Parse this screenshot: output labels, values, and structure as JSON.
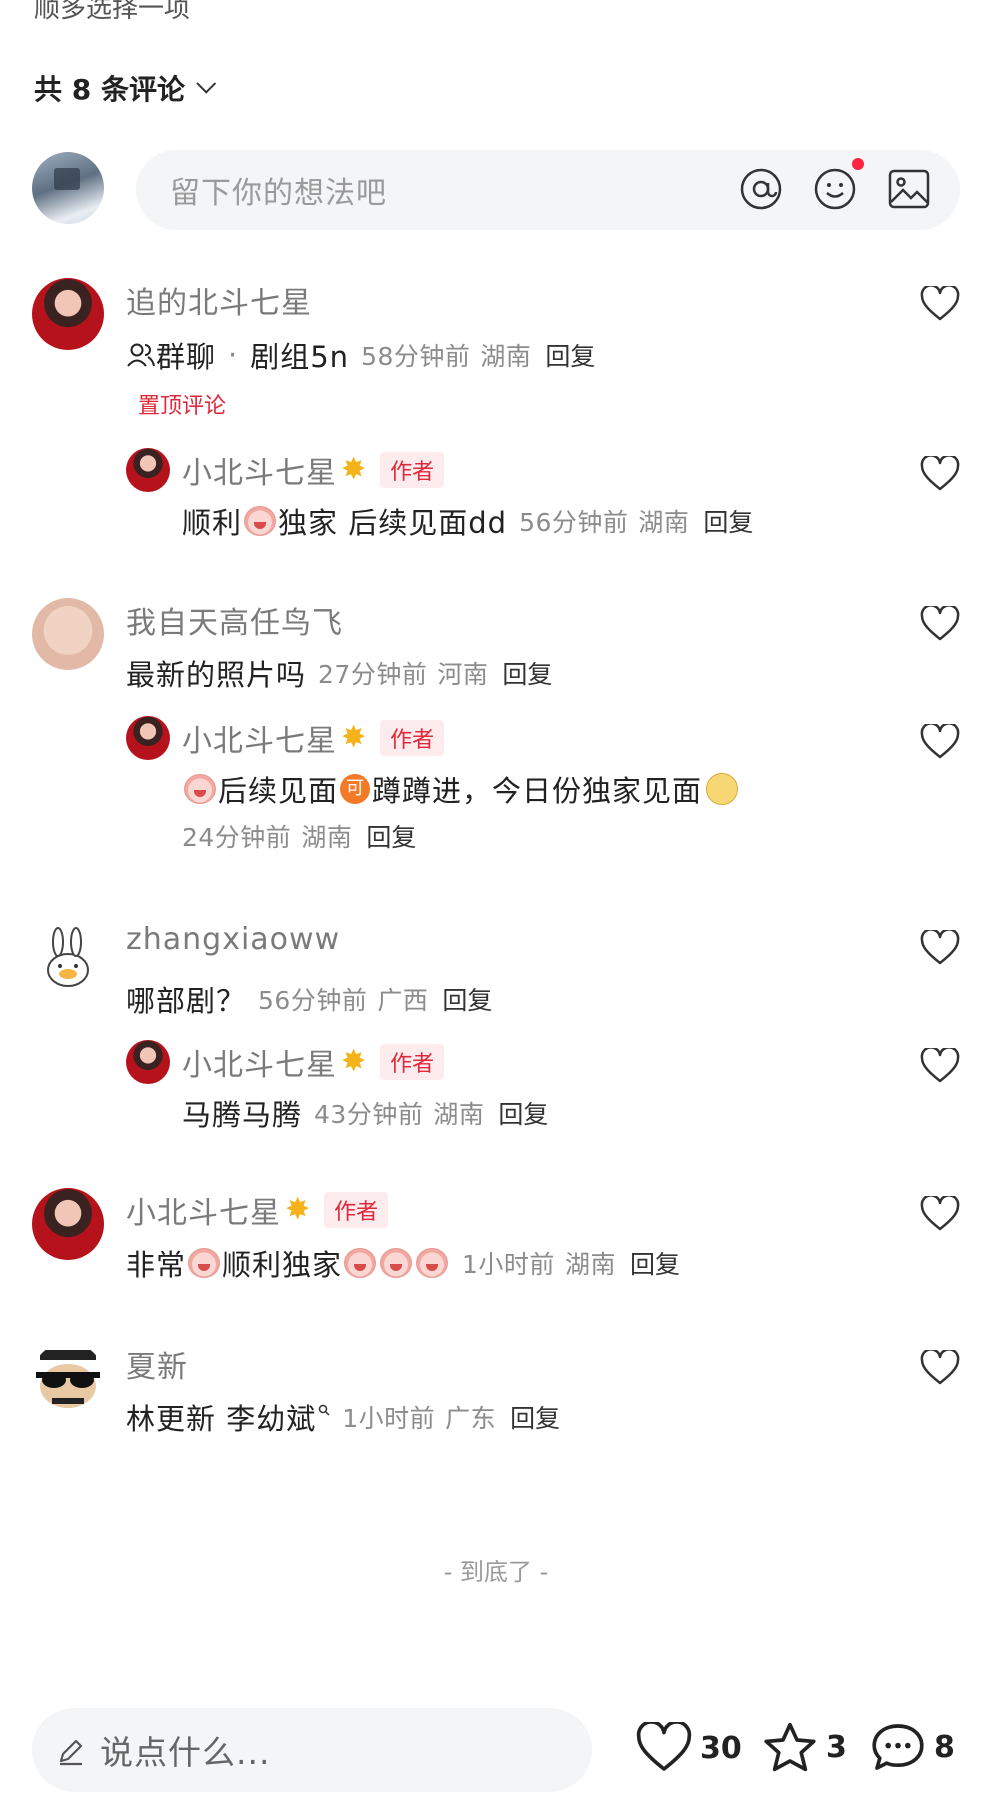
{
  "top_cut_text": "顺多选择一项",
  "comments_header": {
    "label": "共 8 条评论"
  },
  "composer": {
    "placeholder": "留下你的想法吧"
  },
  "comments": [
    {
      "name": "追的北斗七星",
      "group_label": "群聊",
      "dot": "·",
      "crew": "剧组5n",
      "time": "58分钟前",
      "location": "湖南",
      "reply": "回复",
      "pinned": "置顶评论",
      "reply_item": {
        "name": "小北斗七星",
        "author_tag": "作者",
        "text_a": "顺利",
        "text_b": "独家 后续见面dd",
        "time": "56分钟前",
        "location": "湖南",
        "reply": "回复"
      }
    },
    {
      "name": "我自天高任鸟飞",
      "text": "最新的照片吗",
      "time": "27分钟前",
      "location": "河南",
      "reply": "回复",
      "reply_item": {
        "name": "小北斗七星",
        "author_tag": "作者",
        "text_a": "后续见面",
        "coin": "可",
        "text_b": "蹲蹲进，今日份独家见面",
        "time": "24分钟前",
        "location": "湖南",
        "reply": "回复"
      }
    },
    {
      "name": "zhangxiaoww",
      "text": "哪部剧？",
      "time": "56分钟前",
      "location": "广西",
      "reply": "回复",
      "reply_item": {
        "name": "小北斗七星",
        "author_tag": "作者",
        "text": "马腾马腾",
        "time": "43分钟前",
        "location": "湖南",
        "reply": "回复"
      }
    },
    {
      "name": "小北斗七星",
      "author_tag": "作者",
      "text_a": "非常",
      "text_b": "顺利独家",
      "time": "1小时前",
      "location": "湖南",
      "reply": "回复"
    },
    {
      "name": "夏新",
      "text": "林更新 李幼斌",
      "time": "1小时前",
      "location": "广东",
      "reply": "回复"
    }
  ],
  "end_text": "- 到底了 -",
  "bottom_bar": {
    "placeholder": "说点什么...",
    "likes": "30",
    "favorites": "3",
    "comments": "8"
  },
  "colors": {
    "accent_red": "#ff2442",
    "author_tag_red": "#e0283a"
  }
}
